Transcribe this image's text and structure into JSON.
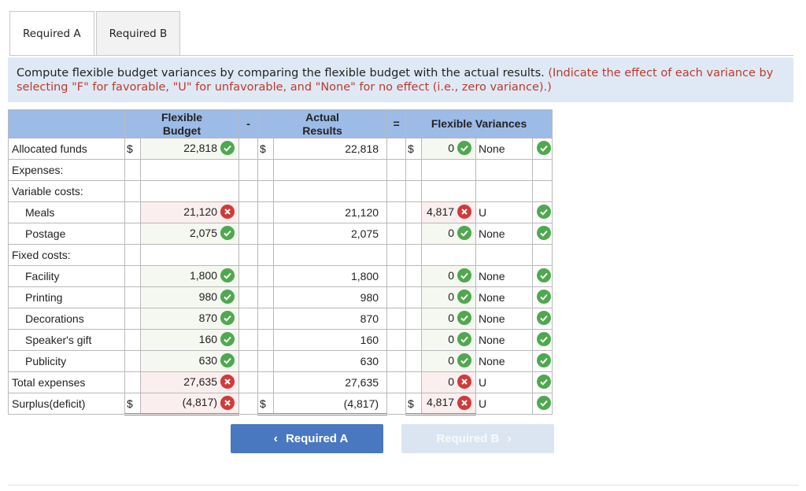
{
  "tabs": [
    {
      "label": "Required A",
      "active": true
    },
    {
      "label": "Required B",
      "active": false
    }
  ],
  "instructions": {
    "main": "Compute flexible budget variances by comparing the flexible budget with the actual  results.",
    "note": "(Indicate the effect of each variance by selecting \"F\" for favorable, \"U\" for unfavorable, and \"None\" for no effect (i.e., zero variance).)"
  },
  "table": {
    "headers": {
      "flexible": [
        "Flexible",
        "Budget"
      ],
      "minus": "-",
      "actual": [
        "Actual",
        "Results"
      ],
      "equals": "=",
      "variances": "Flexible Variances"
    },
    "rows": {
      "allocated": {
        "label": "Allocated funds",
        "flex": "22,818",
        "actual": "22,818",
        "var": "0",
        "effect": "None"
      },
      "expenses": {
        "label": "Expenses:"
      },
      "variable": {
        "label": "Variable costs:"
      },
      "meals": {
        "label": "Meals",
        "flex": "21,120",
        "actual": "21,120",
        "var": "4,817",
        "effect": "U"
      },
      "postage": {
        "label": "Postage",
        "flex": "2,075",
        "actual": "2,075",
        "var": "0",
        "effect": "None"
      },
      "fixed": {
        "label": "Fixed costs:"
      },
      "facility": {
        "label": "Facility",
        "flex": "1,800",
        "actual": "1,800",
        "var": "0",
        "effect": "None"
      },
      "printing": {
        "label": "Printing",
        "flex": "980",
        "actual": "980",
        "var": "0",
        "effect": "None"
      },
      "decorations": {
        "label": "Decorations",
        "flex": "870",
        "actual": "870",
        "var": "0",
        "effect": "None"
      },
      "gift": {
        "label": "Speaker's gift",
        "flex": "160",
        "actual": "160",
        "var": "0",
        "effect": "None"
      },
      "publicity": {
        "label": "Publicity",
        "flex": "630",
        "actual": "630",
        "var": "0",
        "effect": "None"
      },
      "total": {
        "label": "Total expenses",
        "flex": "27,635",
        "actual": "27,635",
        "var": "0",
        "effect": "U"
      },
      "surplus": {
        "label": "Surplus(deficit)",
        "flex": "(4,817)",
        "actual": "(4,817)",
        "var": "4,817",
        "effect": "U"
      }
    },
    "currency": "$"
  },
  "buttons": {
    "prev": "Required A",
    "next": "Required B"
  },
  "colors": {
    "header_bg": "#9dbbe7",
    "instruction_bg": "#dfe9f6",
    "note_text": "#c0392b",
    "correct": "#4fa84f",
    "incorrect": "#d13a3a",
    "prev_button": "#4a78c0",
    "next_button_disabled": "#dbe5f1"
  },
  "icons": {
    "correct": "check-circle-icon",
    "incorrect": "x-circle-icon"
  }
}
